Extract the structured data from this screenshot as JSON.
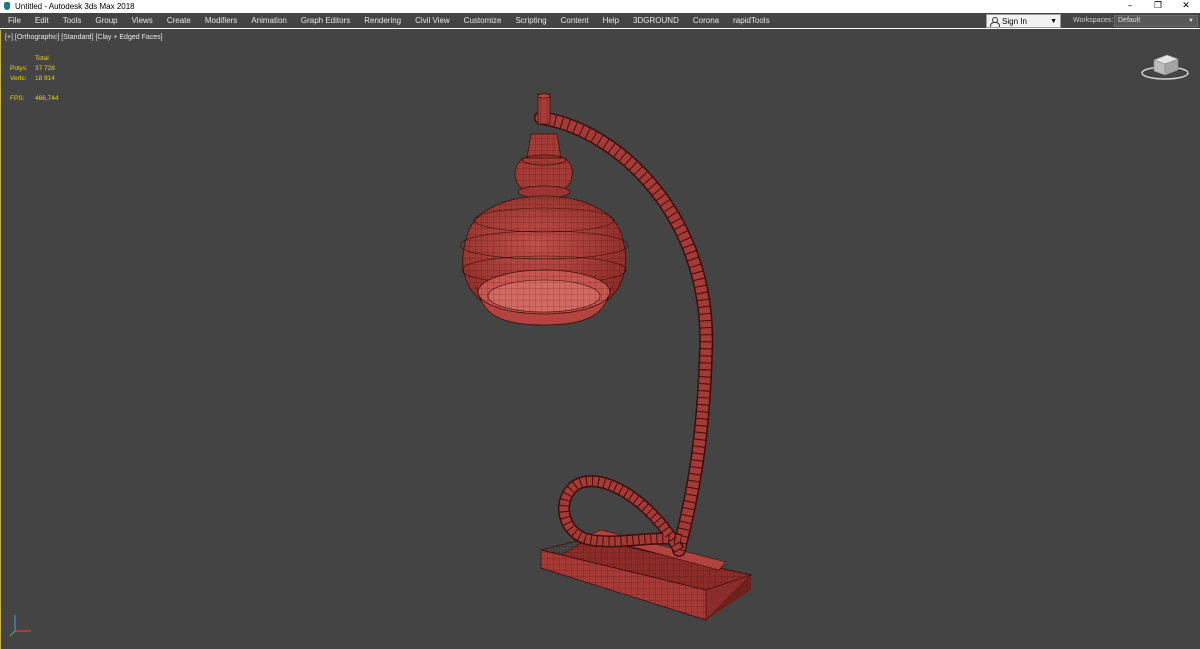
{
  "window": {
    "title": "Untitled - Autodesk 3ds Max 2018",
    "controls": [
      "–",
      "❐",
      "✕"
    ]
  },
  "menu": {
    "items": [
      "File",
      "Edit",
      "Tools",
      "Group",
      "Views",
      "Create",
      "Modifiers",
      "Animation",
      "Graph Editors",
      "Rendering",
      "Civil View",
      "Customize",
      "Scripting",
      "Content",
      "Help",
      "3DGROUND",
      "Corona",
      "rapidTools"
    ]
  },
  "account": {
    "signin_label": "Sign In",
    "workspaces_label": "Workspaces:",
    "workspace_value": "Default"
  },
  "viewport": {
    "label": "[+] [Orthographic] [Standard] [Clay + Edged Faces]",
    "stats": {
      "header": "Total",
      "polys_label": "Polys:",
      "polys_value": "37 728",
      "verts_label": "Verts:",
      "verts_value": "18 914",
      "fps_label": "FPS:",
      "fps_value": "466,744"
    }
  },
  "colors": {
    "viewport_bg": "#444444",
    "model_fill": "#a53a36",
    "model_wire": "#3a0e0c",
    "stats_text": "#e8d800",
    "viewport_border": "#c8b24a"
  },
  "icons": {
    "app": "3ds-max-logo-icon",
    "user": "user-icon",
    "viewcube": "viewcube-icon",
    "axis": "axis-tripod-icon"
  }
}
